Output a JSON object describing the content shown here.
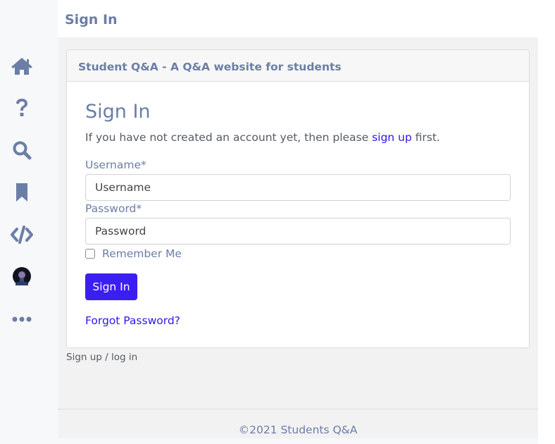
{
  "header": {
    "title": "Sign In"
  },
  "sidebar": {
    "items": [
      {
        "icon": "home-icon"
      },
      {
        "icon": "question-icon"
      },
      {
        "icon": "search-icon"
      },
      {
        "icon": "bookmark-icon"
      },
      {
        "icon": "code-icon"
      },
      {
        "icon": "avatar"
      },
      {
        "icon": "more-icon"
      }
    ],
    "icon_color": "#6b7ea6"
  },
  "card": {
    "header": "Student Q&A - A Q&A website for students",
    "form_title": "Sign In",
    "intro_before": "If you have not created an account yet, then please ",
    "intro_link": "sign up",
    "intro_after": " first.",
    "username_label": "Username*",
    "username_placeholder": "Username",
    "password_label": "Password*",
    "password_placeholder": "Password",
    "remember_label": "Remember Me",
    "submit_label": "Sign In",
    "forgot_label": "Forgot Password?"
  },
  "subtext": "Sign up / log in",
  "footer": {
    "text": "©2021 Students Q&A"
  },
  "colors": {
    "accent": "#3b1ef0",
    "link": "#2b17e8",
    "muted": "#6b7ea6"
  }
}
